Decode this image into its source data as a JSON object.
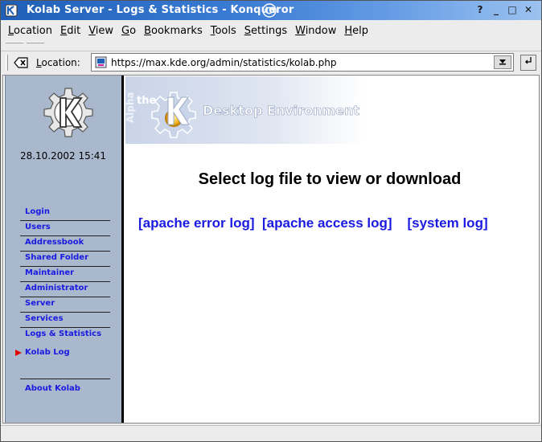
{
  "window": {
    "title": "Kolab Server - Logs & Statistics - Konqueror",
    "controls": [
      "?",
      "_",
      "□",
      "✕"
    ]
  },
  "menubar": {
    "items": [
      {
        "u": "L",
        "rest": "ocation"
      },
      {
        "u": "E",
        "rest": "dit"
      },
      {
        "u": "V",
        "rest": "iew"
      },
      {
        "u": "G",
        "rest": "o"
      },
      {
        "u": "B",
        "rest": "ookmarks"
      },
      {
        "u": "T",
        "rest": "ools"
      },
      {
        "u": "S",
        "rest": "ettings"
      },
      {
        "u": "W",
        "rest": "indow"
      },
      {
        "u": "H",
        "rest": "elp"
      }
    ]
  },
  "location": {
    "label_u": "L",
    "label_rest": "ocation:",
    "url": "https://max.kde.org/admin/statistics/kolab.php"
  },
  "sidebar": {
    "datetime": "28.10.2002 15:41",
    "nav": [
      {
        "label": "Login"
      },
      {
        "label": "Users"
      },
      {
        "label": "Addressbook"
      },
      {
        "label": "Shared Folder"
      },
      {
        "label": "Maintainer"
      },
      {
        "label": "Administrator"
      },
      {
        "label": "Server"
      },
      {
        "label": "Services"
      },
      {
        "label": "Logs & Statistics"
      }
    ],
    "current": "Kolab Log",
    "about": "About Kolab"
  },
  "banner": {
    "alpha": "Alpha",
    "the": "the",
    "text": "Desktop Environment"
  },
  "main": {
    "heading": "Select log file to view or download",
    "links": [
      "[apache error log]",
      "[apache access log]",
      "[system log]"
    ]
  }
}
